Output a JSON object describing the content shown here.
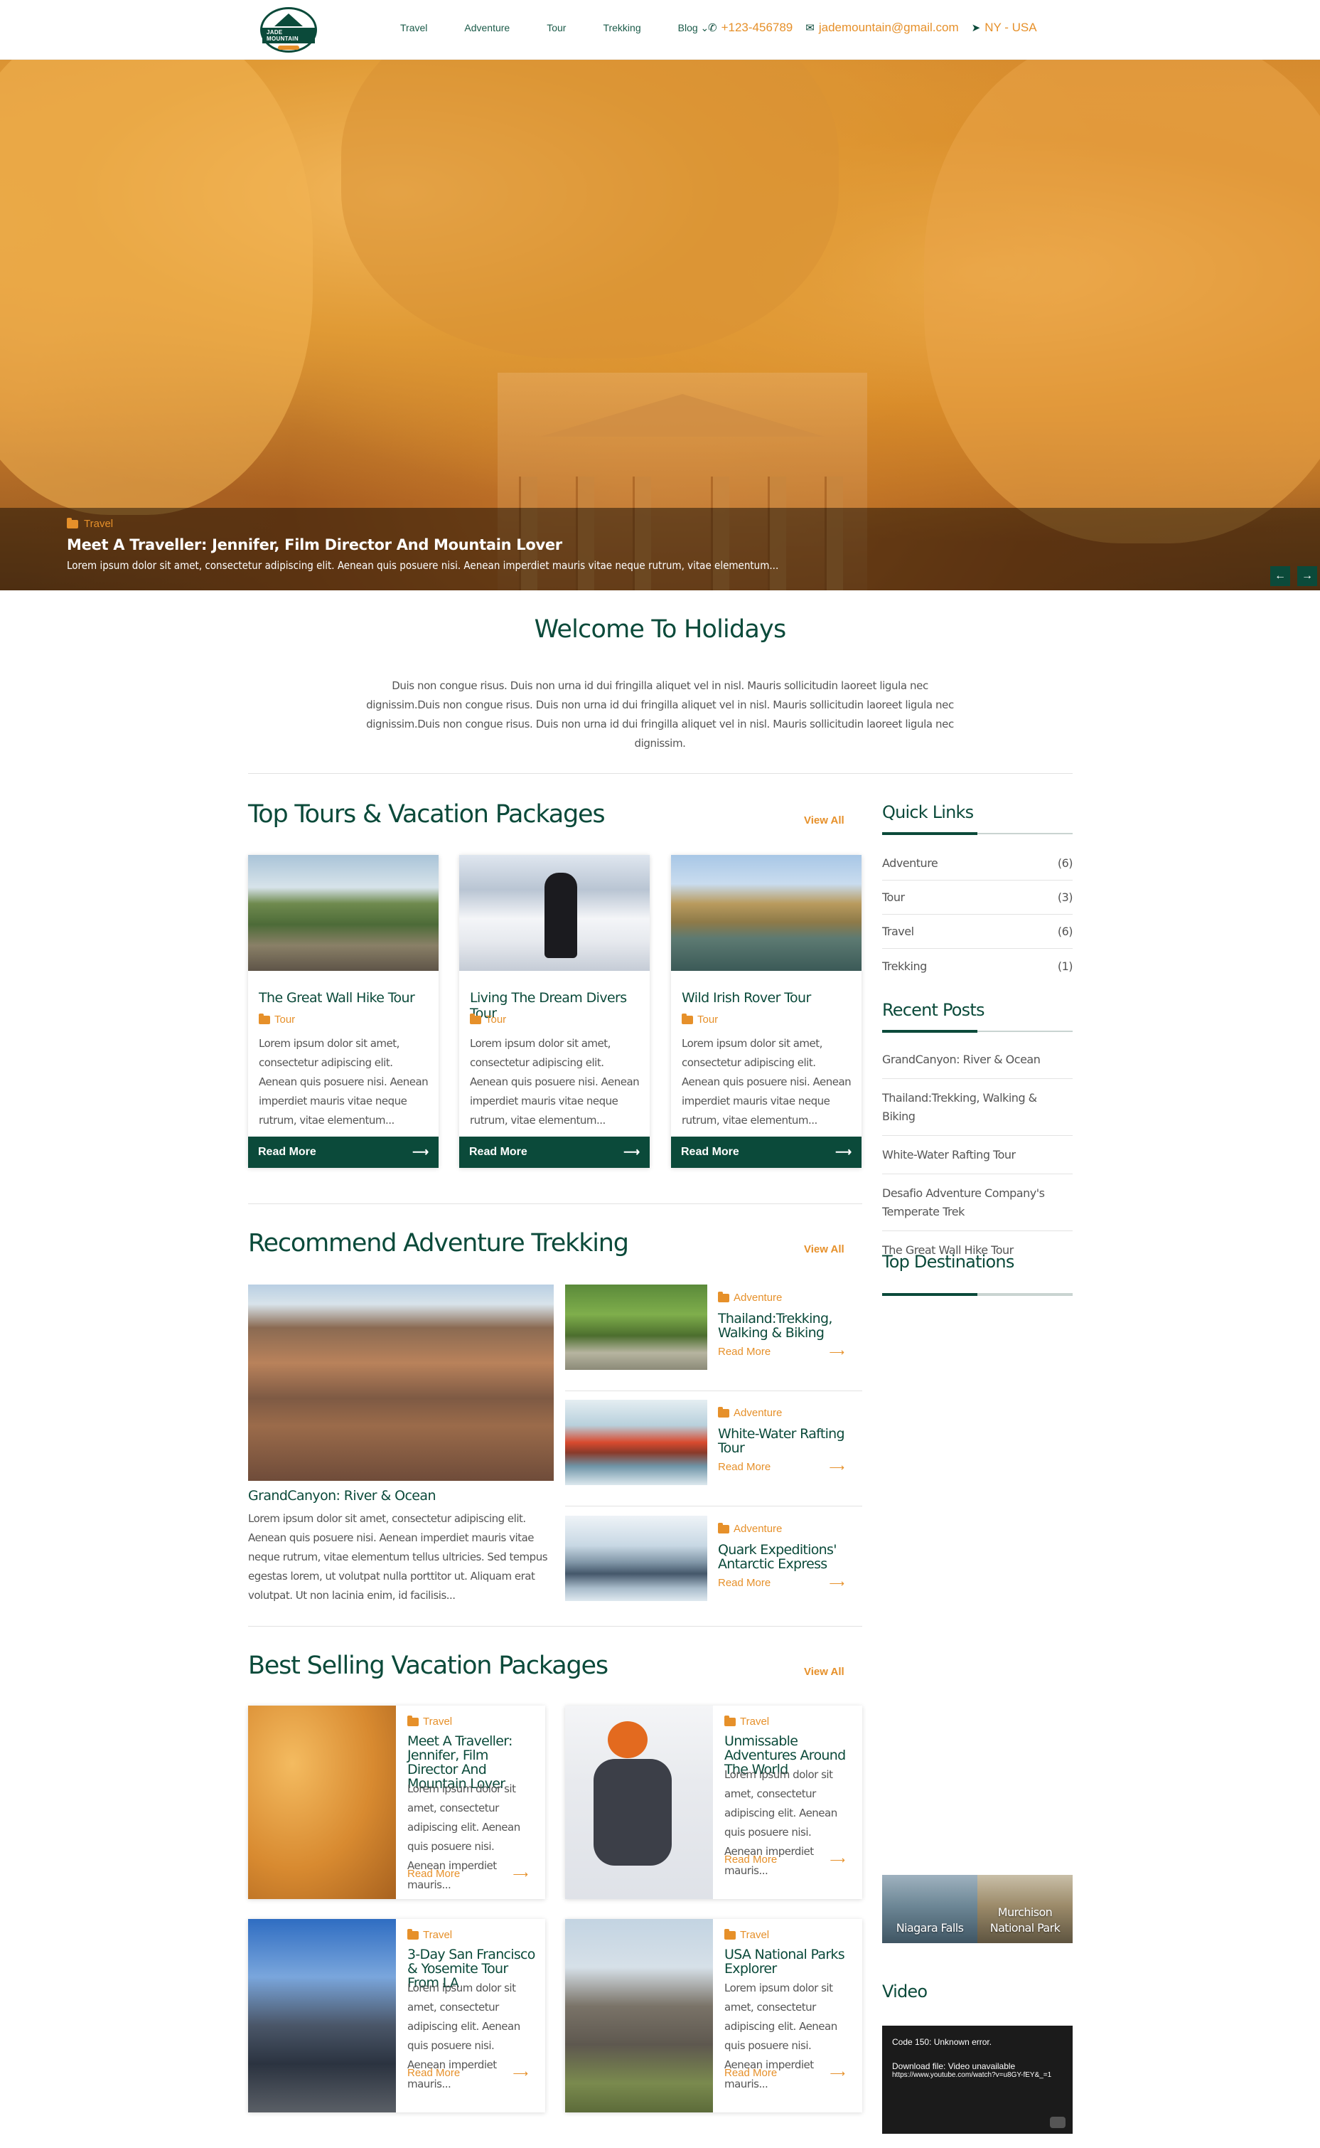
{
  "header": {
    "logo_text": "JADE MOUNTAIN",
    "nav": [
      "Travel",
      "Adventure",
      "Tour",
      "Trekking",
      "Blog"
    ],
    "phone": "+123-456789",
    "email": "jademountain@gmail.com",
    "location": "NY - USA"
  },
  "hero": {
    "category": "Travel",
    "title": "Meet A Traveller: Jennifer, Film Director And Mountain Lover",
    "excerpt": "Lorem ipsum dolor sit amet, consectetur adipiscing elit. Aenean quis posuere nisi. Aenean imperdiet mauris vitae neque rutrum, vitae elementum..."
  },
  "welcome": {
    "title": "Welcome To Holidays",
    "text": "Duis non congue risus. Duis non urna id dui fringilla aliquet vel in nisl. Mauris sollicitudin laoreet ligula nec dignissim.Duis non congue risus. Duis non urna id dui fringilla aliquet vel in nisl. Mauris sollicitudin laoreet ligula nec dignissim.Duis non congue risus. Duis non urna id dui fringilla aliquet vel in nisl. Mauris sollicitudin laoreet ligula nec dignissim."
  },
  "top_tours": {
    "title": "Top Tours & Vacation Packages",
    "view_all": "View All",
    "cards": [
      {
        "title": "The Great Wall Hike Tour",
        "category": "Tour",
        "desc": "Lorem ipsum dolor sit amet, consectetur adipiscing elit. Aenean quis posuere nisi. Aenean imperdiet mauris vitae neque rutrum, vitae elementum...",
        "read_more": "Read More"
      },
      {
        "title": "Living The Dream Divers Tour",
        "category": "Tour",
        "desc": "Lorem ipsum dolor sit amet, consectetur adipiscing elit. Aenean quis posuere nisi. Aenean imperdiet mauris vitae neque rutrum, vitae elementum...",
        "read_more": "Read More"
      },
      {
        "title": "Wild Irish Rover Tour",
        "category": "Tour",
        "desc": "Lorem ipsum dolor sit amet, consectetur adipiscing elit. Aenean quis posuere nisi. Aenean imperdiet mauris vitae neque rutrum, vitae elementum...",
        "read_more": "Read More"
      }
    ]
  },
  "recommend": {
    "title": "Recommend Adventure Trekking",
    "view_all": "View All",
    "featured": {
      "title": "GrandCanyon: River & Ocean",
      "desc": "Lorem ipsum dolor sit amet, consectetur adipiscing elit. Aenean quis posuere nisi. Aenean imperdiet mauris vitae neque rutrum, vitae elementum tellus ultricies. Sed tempus egestas lorem, ut volutpat nulla porttitor ut. Aliquam erat volutpat. Ut non lacinia enim, id facilisis..."
    },
    "items": [
      {
        "category": "Adventure",
        "title": "Thailand:Trekking, Walking & Biking",
        "read_more": "Read More"
      },
      {
        "category": "Adventure",
        "title": "White-Water Rafting Tour",
        "read_more": "Read More"
      },
      {
        "category": "Adventure",
        "title": "Quark Expeditions' Antarctic Express",
        "read_more": "Read More"
      }
    ]
  },
  "best_selling": {
    "title": "Best Selling Vacation Packages",
    "view_all": "View All",
    "items": [
      {
        "category": "Travel",
        "title": "Meet A Traveller: Jennifer, Film Director And Mountain Lover",
        "desc": "Lorem ipsum dolor sit amet, consectetur adipiscing elit. Aenean quis posuere nisi. Aenean imperdiet mauris...",
        "read_more": "Read More"
      },
      {
        "category": "Travel",
        "title": "Unmissable Adventures Around The World",
        "desc": "Lorem ipsum dolor sit amet, consectetur adipiscing elit. Aenean quis posuere nisi. Aenean imperdiet mauris...",
        "read_more": "Read More"
      },
      {
        "category": "Travel",
        "title": "3-Day San Francisco & Yosemite Tour From LA",
        "desc": "Lorem ipsum dolor sit amet, consectetur adipiscing elit. Aenean quis posuere nisi. Aenean imperdiet mauris...",
        "read_more": "Read More"
      },
      {
        "category": "Travel",
        "title": "USA National Parks Explorer",
        "desc": "Lorem ipsum dolor sit amet, consectetur adipiscing elit. Aenean quis posuere nisi. Aenean imperdiet mauris...",
        "read_more": "Read More"
      }
    ]
  },
  "sidebar": {
    "quick_links_title": "Quick Links",
    "quick_links": [
      {
        "label": "Adventure",
        "count": "(6)"
      },
      {
        "label": "Tour",
        "count": "(3)"
      },
      {
        "label": "Travel",
        "count": "(6)"
      },
      {
        "label": "Trekking",
        "count": "(1)"
      }
    ],
    "recent_posts_title": "Recent Posts",
    "recent_posts": [
      "GrandCanyon: River & Ocean",
      "Thailand:Trekking, Walking & Biking",
      "White-Water Rafting Tour",
      "Desafio Adventure Company's Temperate Trek",
      "The Great Wall Hike Tour"
    ],
    "top_destinations_title": "Top Destinations",
    "destinations": [
      "Niagara Falls",
      "Murchison National Park"
    ],
    "video_title": "Video",
    "video": {
      "error": "Code 150: Unknown error.",
      "line2": "Download file: Video unavailable",
      "line3": "https://www.youtube.com/watch?v=u8GY-fEY&_=1"
    }
  },
  "colors": {
    "brand": "#0b4a3a",
    "accent": "#e6902a"
  }
}
